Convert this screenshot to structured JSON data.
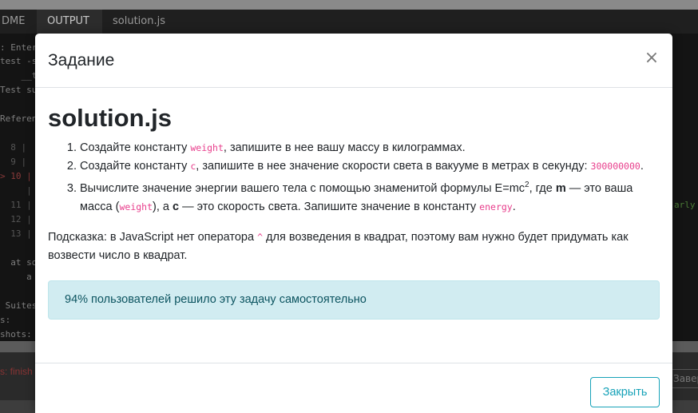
{
  "ide": {
    "topstrip_text": "",
    "tabs": [
      {
        "label": "DME"
      },
      {
        "label": "OUTPUT"
      },
      {
        "label": "solution.js"
      }
    ],
    "terminal_lines": [
      ": Enter",
      "test -s",
      "    __te",
      "Test su",
      "Referen",
      "  8 |",
      "  9 |",
      "> 10 |",
      "     |",
      "  11 |",
      "  12 |",
      "  13 |",
      "  at so",
      "     a",
      " Suites",
      "s:",
      "shots:",
      "arly"
    ],
    "status_text": "s: finish",
    "bottom_button_label": "Завер"
  },
  "modal": {
    "title": "Задание",
    "close_symbol": "×",
    "heading": "solution.js",
    "steps": [
      {
        "before": "Создайте константу ",
        "code": "weight",
        "after": ", запишите в нее вашу массу в килограммах."
      },
      {
        "before": "Создайте константу ",
        "code": "c",
        "after": ", запишите в нее значение скорости света в вакууме в метрах в секунду: ",
        "code2": "300000000",
        "after2": "."
      },
      {
        "part1": "Вычислите значение энергии вашего тела с помощью знаменитой формулы E=mc",
        "sup": "2",
        "part2": ", где ",
        "bold1": "m",
        "part3": " — это ваша масса (",
        "code": "weight",
        "part4": "), а ",
        "bold2": "c",
        "part5": " — это скорость света. Запишите значение в константу ",
        "code2": "energy",
        "part6": "."
      }
    ],
    "hint": {
      "before": "Подсказка: в JavaScript нет оператора ",
      "code": "^",
      "after": " для возведения в квадрат, поэтому вам нужно будет придумать как возвести число в квадрат."
    },
    "alert_text": "94% пользователей решило эту задачу самостоятельно",
    "footer_button_label": "Закрыть"
  }
}
